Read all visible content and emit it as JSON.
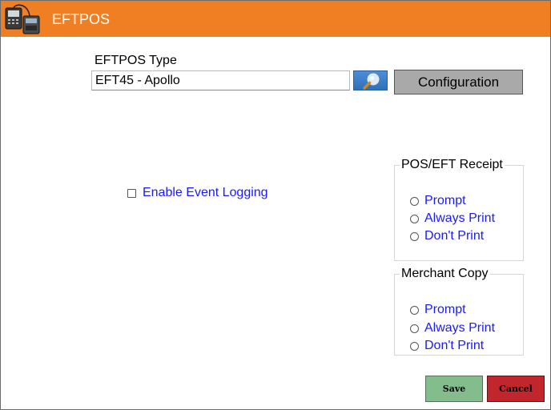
{
  "window": {
    "title": "EFTPOS",
    "icon": "eftpos-terminal-icon",
    "accent_color": "#ef7f22"
  },
  "eftpos_type": {
    "label": "EFTPOS Type",
    "value": "EFT45 - Apollo",
    "search_icon": "magnifier-icon",
    "configuration_label": "Configuration"
  },
  "event_logging": {
    "label": "Enable Event Logging",
    "checked": false
  },
  "pos_eft_receipt": {
    "legend": "POS/EFT Receipt",
    "options": [
      "Prompt",
      "Always Print",
      "Don't Print"
    ]
  },
  "merchant_copy": {
    "legend": "Merchant Copy",
    "options": [
      "Prompt",
      "Always Print",
      "Don't Print"
    ]
  },
  "footer": {
    "save_label": "Save",
    "save_color": "#84bd8d",
    "cancel_label": "Cancel",
    "cancel_color": "#c0262b"
  }
}
